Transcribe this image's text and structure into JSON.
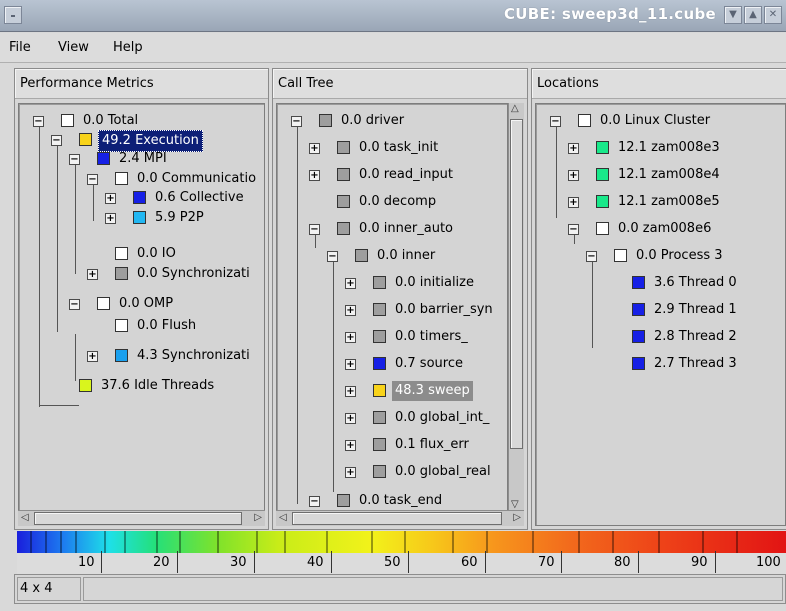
{
  "window": {
    "title": "CUBE: sweep3d_11.cube"
  },
  "menu": [
    "File",
    "View",
    "Help"
  ],
  "panels": {
    "metrics": {
      "header": "Performance Metrics",
      "nodes": [
        {
          "text": "0.0 Total"
        },
        {
          "text": "49.2 Execution"
        },
        {
          "text": "2.4 MPI"
        },
        {
          "text": "0.0 Communicatio"
        },
        {
          "text": "0.6 Collective"
        },
        {
          "text": "5.9 P2P"
        },
        {
          "text": "0.0 IO"
        },
        {
          "text": "0.0 Synchronizati"
        },
        {
          "text": "0.0 OMP"
        },
        {
          "text": "0.0 Flush"
        },
        {
          "text": "4.3 Synchronizati"
        },
        {
          "text": "37.6 Idle Threads"
        }
      ]
    },
    "calltree": {
      "header": "Call Tree",
      "nodes": [
        {
          "text": "0.0 driver"
        },
        {
          "text": "0.0 task_init"
        },
        {
          "text": "0.0 read_input"
        },
        {
          "text": "0.0 decomp"
        },
        {
          "text": "0.0 inner_auto"
        },
        {
          "text": "0.0 inner"
        },
        {
          "text": "0.0 initialize"
        },
        {
          "text": "0.0 barrier_syn"
        },
        {
          "text": "0.0 timers_"
        },
        {
          "text": "0.7 source"
        },
        {
          "text": "48.3 sweep"
        },
        {
          "text": "0.0 global_int_"
        },
        {
          "text": "0.1 flux_err"
        },
        {
          "text": "0.0 global_real"
        },
        {
          "text": "0.0 task_end"
        }
      ]
    },
    "locations": {
      "header": "Locations",
      "nodes": [
        {
          "text": "0.0 Linux Cluster"
        },
        {
          "text": "12.1 zam008e3"
        },
        {
          "text": "12.1 zam008e4"
        },
        {
          "text": "12.1 zam008e5"
        },
        {
          "text": "0.0 zam008e6"
        },
        {
          "text": "0.0 Process 3"
        },
        {
          "text": "3.6 Thread 0"
        },
        {
          "text": "2.9 Thread 1"
        },
        {
          "text": "2.8 Thread 2"
        },
        {
          "text": "2.7 Thread 3"
        }
      ]
    }
  },
  "colors": {
    "white": "#ffffff",
    "gray": "#9e9e9e",
    "blue": "#1620e6",
    "lightblue": "#1aa0ee",
    "cyan": "#22b7f2",
    "green": "#19e88a",
    "lime": "#d9f51d",
    "yellow": "#f8d31a"
  },
  "scale": {
    "labels": [
      "10",
      "20",
      "30",
      "40",
      "50",
      "60",
      "70",
      "80",
      "90",
      "100"
    ]
  },
  "status": {
    "grid": "4 x 4"
  }
}
